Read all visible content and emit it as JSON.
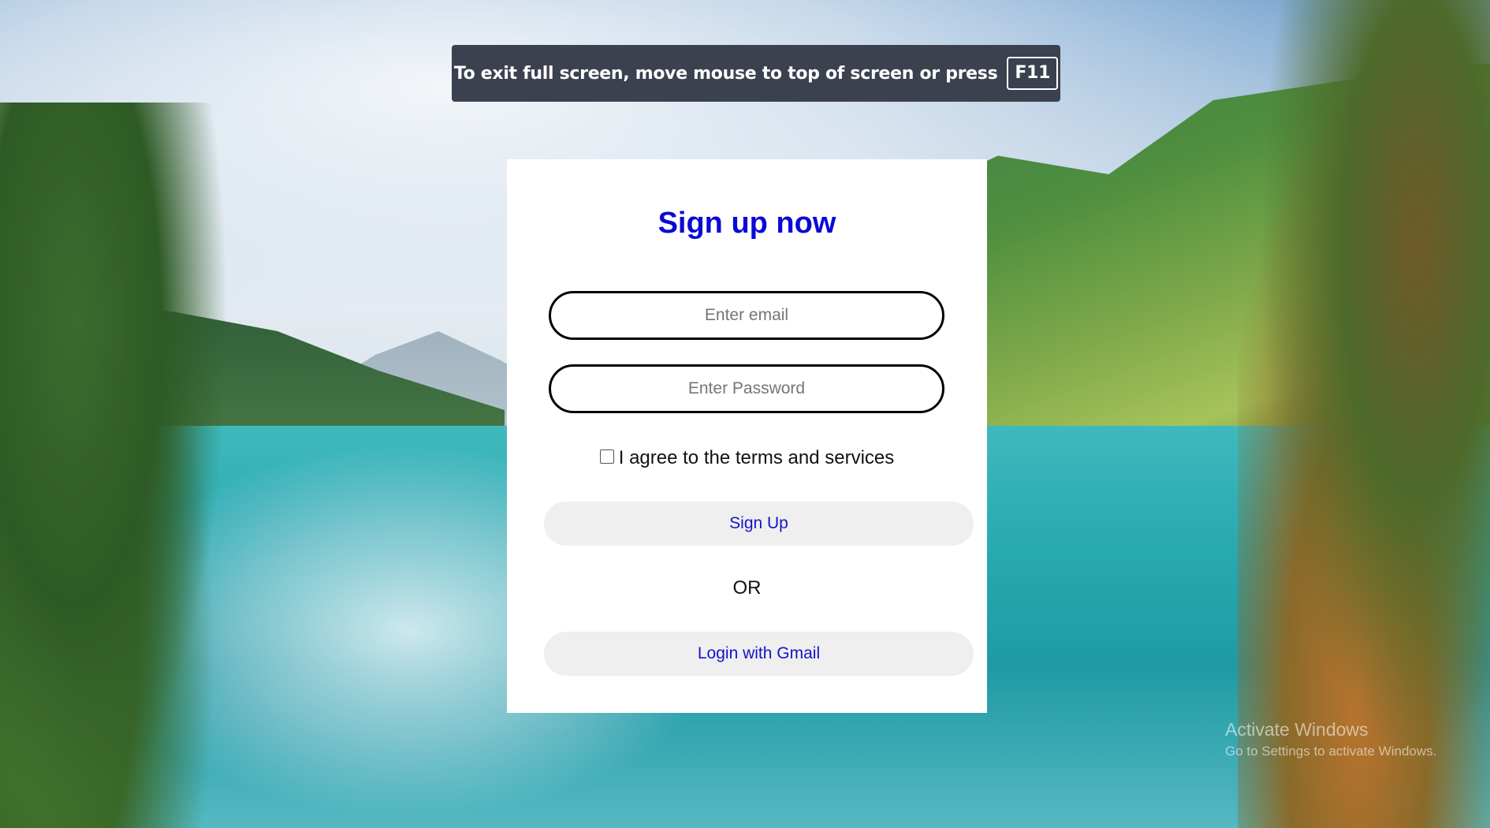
{
  "banner": {
    "message": "To exit full screen, move mouse to top of screen or press",
    "key": "F11"
  },
  "signup_form": {
    "title": "Sign up now",
    "email_placeholder": "Enter email",
    "password_placeholder": "Enter Password",
    "agree_label": "I agree to the terms and services",
    "agree_checked": false,
    "signup_button": "Sign Up",
    "or_text": "OR",
    "gmail_button": "Login with Gmail"
  },
  "watermark": {
    "title": "Activate Windows",
    "subtitle": "Go to Settings to activate Windows."
  },
  "colors": {
    "title_blue": "#0a0ad6",
    "button_text_blue": "#1414c8",
    "banner_bg": "#3c4150"
  }
}
